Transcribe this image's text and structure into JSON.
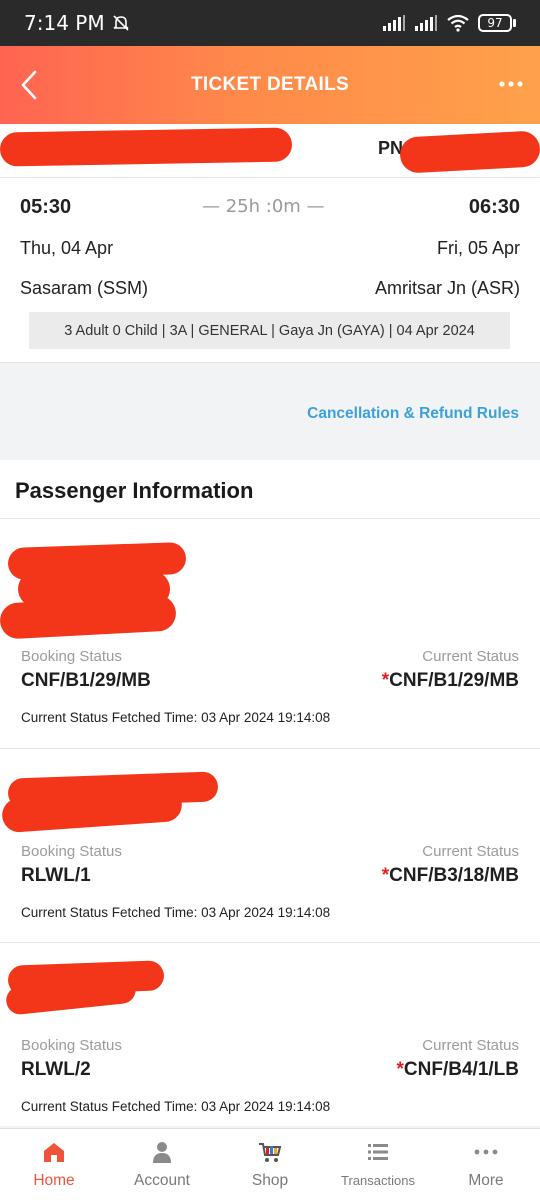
{
  "status_bar": {
    "time": "7:14 PM",
    "battery": "97"
  },
  "header": {
    "title": "TICKET DETAILS"
  },
  "journey": {
    "pnr_label": "PN",
    "departure_time": "05:30",
    "arrival_time": "06:30",
    "duration": "— 25h :0m —",
    "departure_date": "Thu, 04 Apr",
    "arrival_date": "Fri, 05 Apr",
    "from_station": "Sasaram (SSM)",
    "to_station": "Amritsar Jn (ASR)",
    "summary": "3 Adult 0 Child  | 3A | GENERAL | Gaya Jn (GAYA) | 04 Apr 2024"
  },
  "refund_link": "Cancellation & Refund Rules",
  "passengers": {
    "title": "Passenger Information",
    "booking_label": "Booking Status",
    "current_label": "Current Status",
    "items": [
      {
        "booking": "CNF/B1/29/MB",
        "star": "*",
        "current": "CNF/B1/29/MB",
        "fetched": "Current Status Fetched Time: 03 Apr 2024 19:14:08"
      },
      {
        "booking": "RLWL/1",
        "star": "*",
        "current": "CNF/B3/18/MB",
        "fetched": "Current Status Fetched Time: 03 Apr 2024 19:14:08"
      },
      {
        "booking": "RLWL/2",
        "star": "*",
        "current": "CNF/B4/1/LB",
        "fetched": "Current Status Fetched Time: 03 Apr 2024 19:14:08"
      }
    ]
  },
  "nav": [
    {
      "label": "Home",
      "icon": "home-icon",
      "active": true
    },
    {
      "label": "Account",
      "icon": "account-icon"
    },
    {
      "label": "Shop",
      "icon": "shop-cart-icon"
    },
    {
      "label": "Transactions",
      "icon": "transactions-list-icon"
    },
    {
      "label": "More",
      "icon": "more-dots-icon"
    }
  ],
  "colors": {
    "accent": "#f0533a",
    "link": "#3ca0db",
    "star": "#e02020",
    "redaction": "#f3351a"
  }
}
